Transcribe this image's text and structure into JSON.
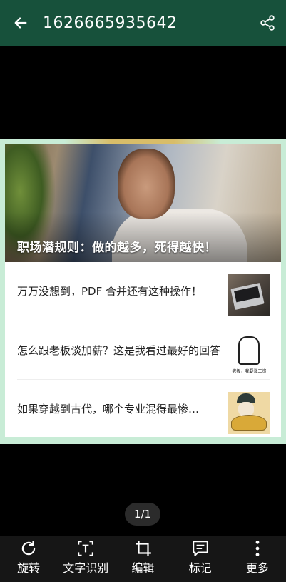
{
  "header": {
    "title": "1626665935642",
    "back_icon": "arrow-left-icon",
    "share_icon": "share-icon",
    "background": "#17513b"
  },
  "document": {
    "headline": "职场潜规则：做的越多，死得越快！",
    "articles": [
      {
        "title": "万万没想到，PDF 合并还有这种操作！",
        "thumbnail": "laptop-thumbnail"
      },
      {
        "title": "怎么跟老板谈加薪？这是我看过最好的回答",
        "thumbnail": "boss-illustration-thumbnail",
        "thumbnail_caption": "老板，我要涨工资"
      },
      {
        "title": "如果穿越到古代，哪个专业混得最惨…",
        "thumbnail": "qing-official-thumbnail"
      }
    ]
  },
  "pager": {
    "label": "1/1"
  },
  "toolbar": {
    "items": [
      {
        "label": "旋转",
        "icon": "rotate-icon"
      },
      {
        "label": "文字识别",
        "icon": "text-recognition-icon"
      },
      {
        "label": "编辑",
        "icon": "crop-icon"
      },
      {
        "label": "标记",
        "icon": "annotate-icon"
      },
      {
        "label": "更多",
        "icon": "more-vertical-icon"
      }
    ]
  }
}
